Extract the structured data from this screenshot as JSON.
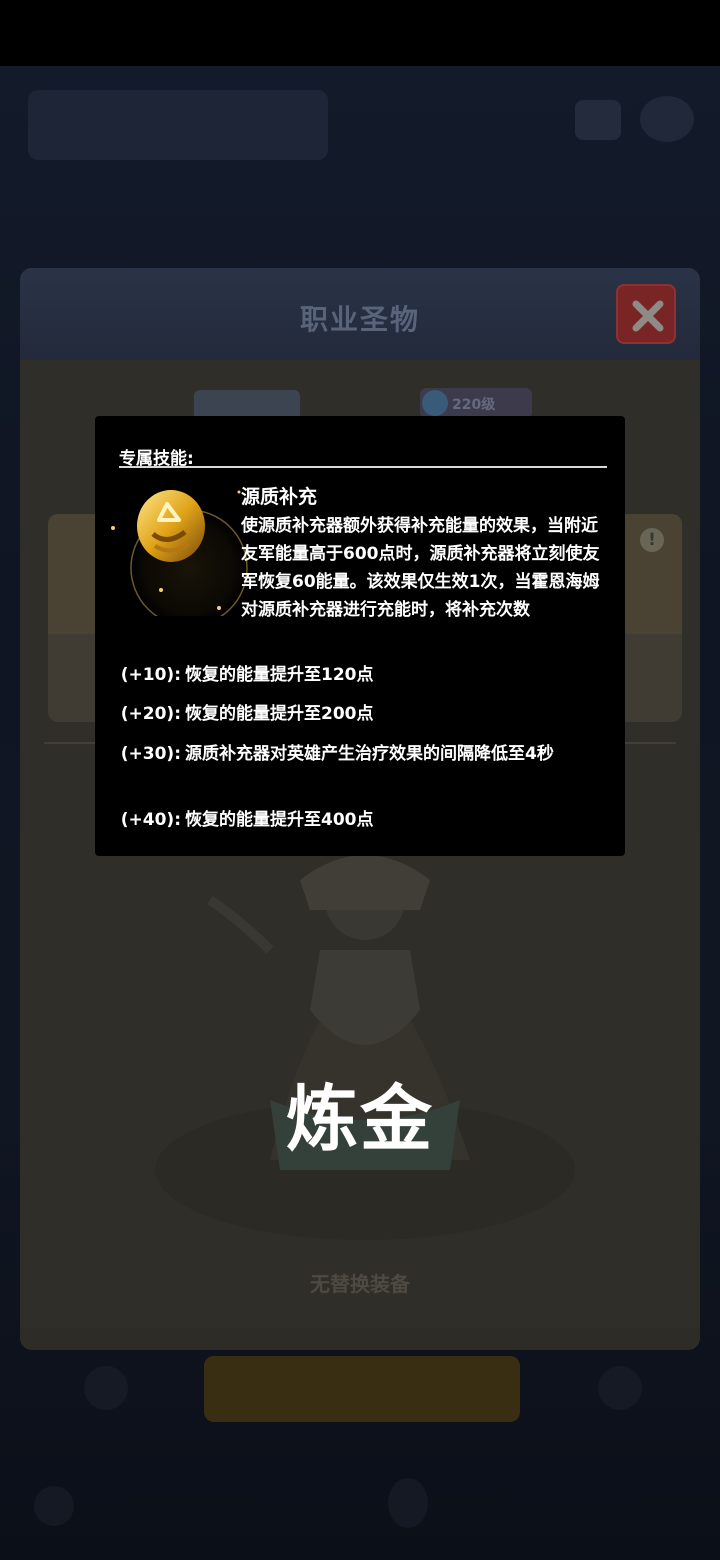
{
  "dialog": {
    "title": "职业圣物",
    "close_icon": "close-icon",
    "level_badge": "220级",
    "hero_name": "炼金",
    "no_equipment_text": "无替换装备"
  },
  "tooltip": {
    "heading": "专属技能:",
    "skill_icon": "golden-orb-icon",
    "skill_name": "源质补充",
    "skill_description": "使源质补充器额外获得补充能量的效果，当附近友军能量高于600点时，源质补充器将立刻使友军恢复60能量。该效果仅生效1次，当霍恩海姆对源质补充器进行充能时，将补充次数",
    "upgrades": [
      {
        "level": "(+10):",
        "text": "恢复的能量提升至120点"
      },
      {
        "level": "(+20):",
        "text": "恢复的能量提升至200点"
      },
      {
        "level": "(+30):",
        "text": "源质补充器对英雄产生治疗效果的间隔降低至4秒"
      },
      {
        "level": "(+40):",
        "text": "恢复的能量提升至400点"
      }
    ]
  },
  "colors": {
    "tooltip_bg": "#000000",
    "close_button": "#7a2525",
    "dialog_bg": "#302e29",
    "header_bg": "#2a3347"
  }
}
